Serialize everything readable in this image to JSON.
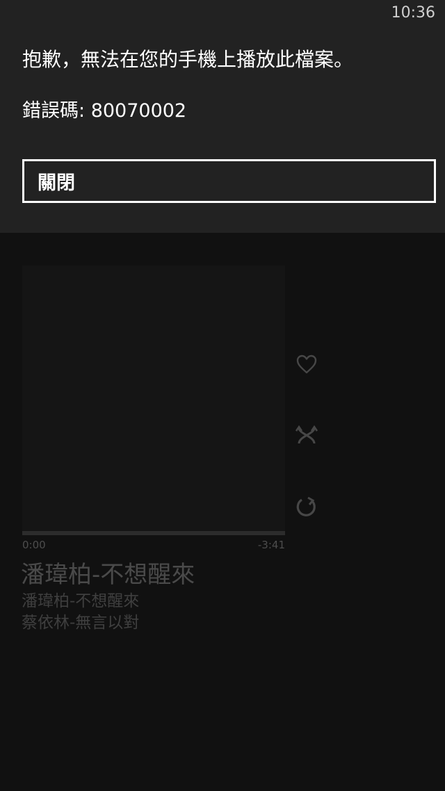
{
  "status_bar": {
    "time": "10:36"
  },
  "dialog": {
    "message": "抱歉，無法在您的手機上播放此檔案。",
    "error_code_label": "錯誤碼",
    "error_code_value": "80070002",
    "close_label": "關閉"
  },
  "player": {
    "elapsed": "0:00",
    "remaining": "-3:41",
    "progress_fraction": 0,
    "now_playing": "潘瑋柏-不想醒來",
    "up_next": [
      "潘瑋柏-不想醒來",
      "蔡依林-無言以對"
    ],
    "controls": [
      {
        "name": "heart-icon"
      },
      {
        "name": "shuffle-icon"
      },
      {
        "name": "repeat-icon"
      }
    ]
  },
  "colors": {
    "dialog_background": "#222222",
    "page_background": "#111111",
    "dim_text": "#4a4a4a"
  }
}
